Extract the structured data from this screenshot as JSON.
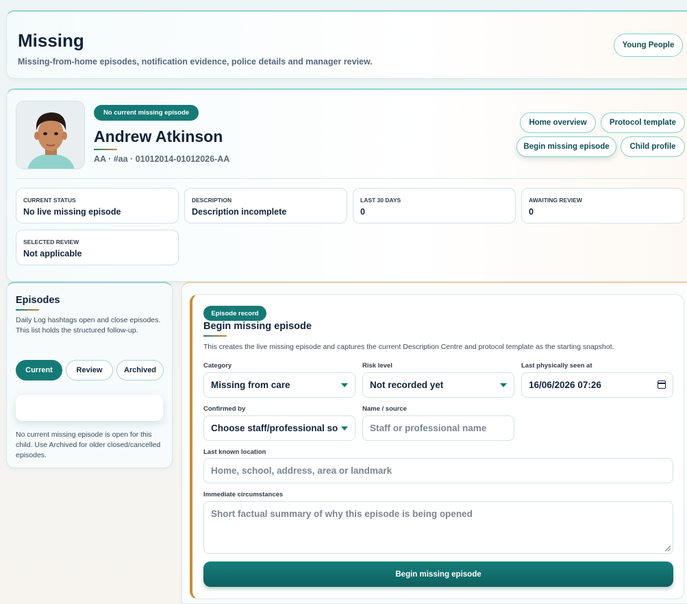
{
  "header": {
    "title": "Missing",
    "subtitle": "Missing-from-home episodes, notification evidence, police details and manager review.",
    "young_people_label": "Young People"
  },
  "profile": {
    "status_badge": "No current missing episode",
    "name": "Andrew Atkinson",
    "meta": "AA · #aa · 01012014-01012026-AA",
    "actions": {
      "home_overview": "Home overview",
      "protocol_template": "Protocol template",
      "begin_missing_episode": "Begin missing episode",
      "child_profile": "Child profile"
    },
    "stats": [
      {
        "label": "CURRENT STATUS",
        "value": "No live missing episode"
      },
      {
        "label": "DESCRIPTION",
        "value": "Description incomplete"
      },
      {
        "label": "LAST 30 DAYS",
        "value": "0"
      },
      {
        "label": "AWAITING REVIEW",
        "value": "0"
      },
      {
        "label": "SELECTED REVIEW",
        "value": "Not applicable"
      }
    ]
  },
  "episodes": {
    "title": "Episodes",
    "description": "Daily Log hashtags open and close episodes. This list holds the structured follow-up.",
    "tabs": [
      "Current",
      "Review",
      "Archived"
    ],
    "empty_text": "No current missing episode is open for this child. Use Archived for older closed/cancelled episodes."
  },
  "form": {
    "badge": "Episode record",
    "title": "Begin missing episode",
    "description": "This creates the live missing episode and captures the current Description Centre and protocol template as the starting snapshot.",
    "category": {
      "label": "Category",
      "value": "Missing from care"
    },
    "risk_level": {
      "label": "Risk level",
      "value": "Not recorded yet"
    },
    "last_seen": {
      "label": "Last physically seen at",
      "value": "16/06/2026 07:26"
    },
    "confirmed_by": {
      "label": "Confirmed by",
      "value": "Choose staff/professional so"
    },
    "name_source": {
      "label": "Name / source",
      "placeholder": "Staff or professional name"
    },
    "last_location": {
      "label": "Last known location",
      "placeholder": "Home, school, address, area or landmark"
    },
    "circumstances": {
      "label": "Immediate circumstances",
      "placeholder": "Short factual summary of why this episode is being opened"
    },
    "submit_label": "Begin missing episode"
  },
  "colors": {
    "accent": "#157a76",
    "accent_warm": "#c98e35"
  }
}
